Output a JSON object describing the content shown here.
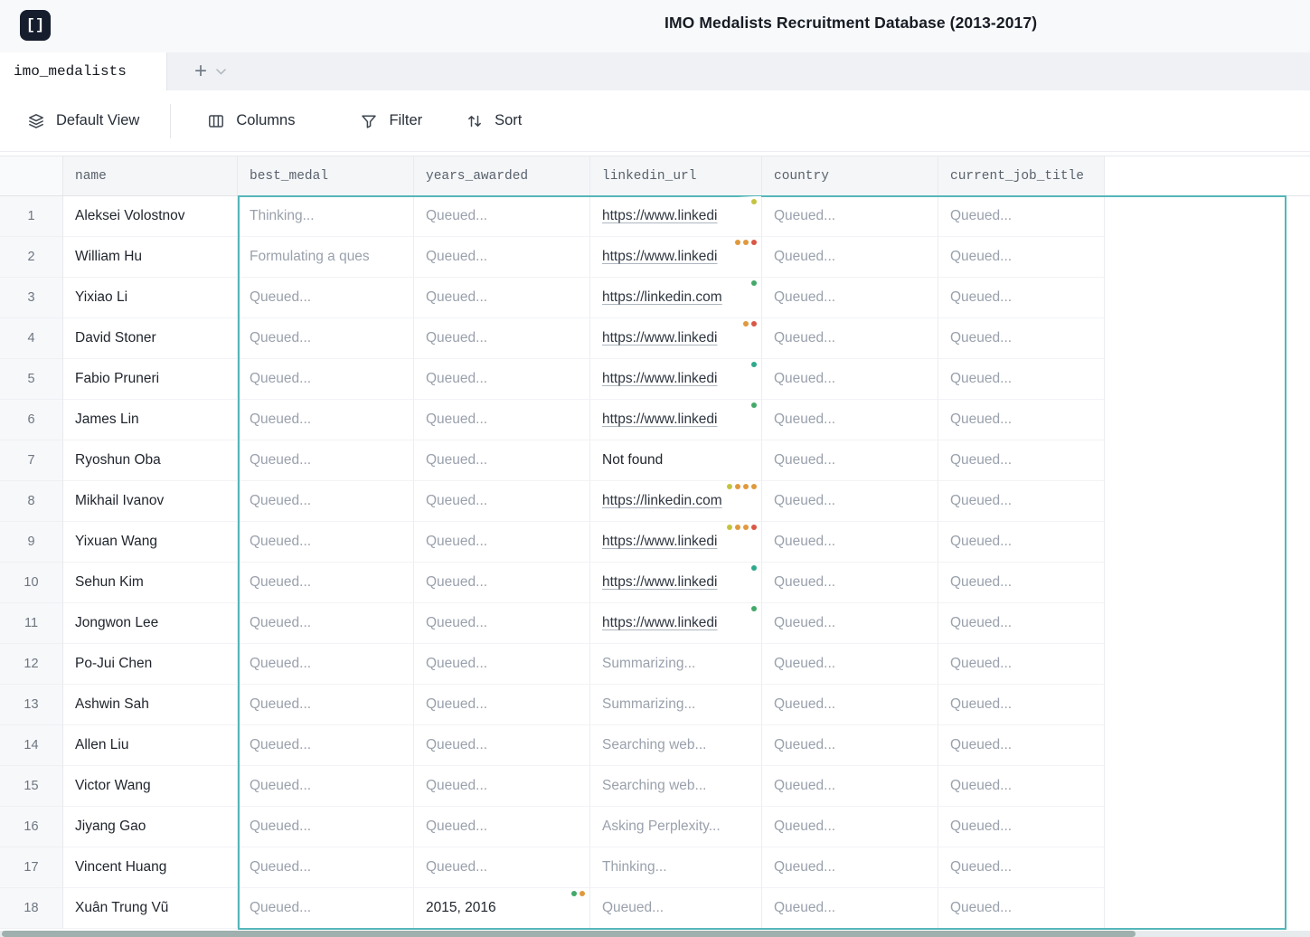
{
  "app": {
    "logo_glyph": "[]",
    "title": "IMO Medalists Recruitment Database (2013-2017)"
  },
  "tab_bar": {
    "active_tab": "imo_medalists",
    "add_tab_label": "+"
  },
  "toolbar": {
    "default_view": "Default View",
    "columns": "Columns",
    "filter": "Filter",
    "sort": "Sort"
  },
  "colors": {
    "selection": "#55b6b9",
    "dot_yellow": "#c5c33e",
    "dot_orange": "#e0993d",
    "dot_red": "#d95745",
    "dot_green": "#43a969",
    "dot_teal": "#2fa98b"
  },
  "table": {
    "columns": [
      "name",
      "best_medal",
      "years_awarded",
      "linkedin_url",
      "country",
      "current_job_title"
    ],
    "rows": [
      {
        "num": "1",
        "cells": [
          {
            "t": "Aleksei Volostnov",
            "k": "name"
          },
          {
            "t": "Thinking...",
            "k": "status"
          },
          {
            "t": "Queued...",
            "k": "status"
          },
          {
            "t": "https://www.linkedi",
            "k": "link",
            "dots": [
              "yellow"
            ]
          },
          {
            "t": "Queued...",
            "k": "status"
          },
          {
            "t": "Queued...",
            "k": "status"
          }
        ]
      },
      {
        "num": "2",
        "cells": [
          {
            "t": "William Hu",
            "k": "name"
          },
          {
            "t": "Formulating a ques",
            "k": "status",
            "fade": true
          },
          {
            "t": "Queued...",
            "k": "status"
          },
          {
            "t": "https://www.linkedi",
            "k": "link",
            "dots": [
              "orange",
              "orange",
              "red"
            ]
          },
          {
            "t": "Queued...",
            "k": "status"
          },
          {
            "t": "Queued...",
            "k": "status"
          }
        ]
      },
      {
        "num": "3",
        "cells": [
          {
            "t": "Yixiao Li",
            "k": "name"
          },
          {
            "t": "Queued...",
            "k": "status"
          },
          {
            "t": "Queued...",
            "k": "status"
          },
          {
            "t": "https://linkedin.com",
            "k": "link",
            "dots": [
              "green"
            ]
          },
          {
            "t": "Queued...",
            "k": "status"
          },
          {
            "t": "Queued...",
            "k": "status"
          }
        ]
      },
      {
        "num": "4",
        "cells": [
          {
            "t": "David Stoner",
            "k": "name"
          },
          {
            "t": "Queued...",
            "k": "status"
          },
          {
            "t": "Queued...",
            "k": "status"
          },
          {
            "t": "https://www.linkedi",
            "k": "link",
            "dots": [
              "orange",
              "red"
            ]
          },
          {
            "t": "Queued...",
            "k": "status"
          },
          {
            "t": "Queued...",
            "k": "status"
          }
        ]
      },
      {
        "num": "5",
        "cells": [
          {
            "t": "Fabio Pruneri",
            "k": "name"
          },
          {
            "t": "Queued...",
            "k": "status"
          },
          {
            "t": "Queued...",
            "k": "status"
          },
          {
            "t": "https://www.linkedi",
            "k": "link",
            "dots": [
              "teal"
            ]
          },
          {
            "t": "Queued...",
            "k": "status"
          },
          {
            "t": "Queued...",
            "k": "status"
          }
        ]
      },
      {
        "num": "6",
        "cells": [
          {
            "t": "James Lin",
            "k": "name"
          },
          {
            "t": "Queued...",
            "k": "status"
          },
          {
            "t": "Queued...",
            "k": "status"
          },
          {
            "t": "https://www.linkedi",
            "k": "link",
            "dots": [
              "green"
            ]
          },
          {
            "t": "Queued...",
            "k": "status"
          },
          {
            "t": "Queued...",
            "k": "status"
          }
        ]
      },
      {
        "num": "7",
        "cells": [
          {
            "t": "Ryoshun Oba",
            "k": "name"
          },
          {
            "t": "Queued...",
            "k": "status"
          },
          {
            "t": "Queued...",
            "k": "status"
          },
          {
            "t": "Not found",
            "k": "text"
          },
          {
            "t": "Queued...",
            "k": "status"
          },
          {
            "t": "Queued...",
            "k": "status"
          }
        ]
      },
      {
        "num": "8",
        "cells": [
          {
            "t": "Mikhail Ivanov",
            "k": "name"
          },
          {
            "t": "Queued...",
            "k": "status"
          },
          {
            "t": "Queued...",
            "k": "status"
          },
          {
            "t": "https://linkedin.com",
            "k": "link",
            "dots": [
              "yellow",
              "orange",
              "orange",
              "orange"
            ]
          },
          {
            "t": "Queued...",
            "k": "status"
          },
          {
            "t": "Queued...",
            "k": "status"
          }
        ]
      },
      {
        "num": "9",
        "cells": [
          {
            "t": "Yixuan Wang",
            "k": "name"
          },
          {
            "t": "Queued...",
            "k": "status"
          },
          {
            "t": "Queued...",
            "k": "status"
          },
          {
            "t": "https://www.linkedi",
            "k": "link",
            "dots": [
              "yellow",
              "orange",
              "orange",
              "red"
            ]
          },
          {
            "t": "Queued...",
            "k": "status"
          },
          {
            "t": "Queued...",
            "k": "status"
          }
        ]
      },
      {
        "num": "10",
        "cells": [
          {
            "t": "Sehun Kim",
            "k": "name"
          },
          {
            "t": "Queued...",
            "k": "status"
          },
          {
            "t": "Queued...",
            "k": "status"
          },
          {
            "t": "https://www.linkedi",
            "k": "link",
            "dots": [
              "teal"
            ]
          },
          {
            "t": "Queued...",
            "k": "status"
          },
          {
            "t": "Queued...",
            "k": "status"
          }
        ]
      },
      {
        "num": "11",
        "cells": [
          {
            "t": "Jongwon Lee",
            "k": "name"
          },
          {
            "t": "Queued...",
            "k": "status"
          },
          {
            "t": "Queued...",
            "k": "status"
          },
          {
            "t": "https://www.linkedi",
            "k": "link",
            "dots": [
              "green"
            ]
          },
          {
            "t": "Queued...",
            "k": "status"
          },
          {
            "t": "Queued...",
            "k": "status"
          }
        ]
      },
      {
        "num": "12",
        "cells": [
          {
            "t": "Po-Jui Chen",
            "k": "name"
          },
          {
            "t": "Queued...",
            "k": "status"
          },
          {
            "t": "Queued...",
            "k": "status"
          },
          {
            "t": "Summarizing...",
            "k": "status"
          },
          {
            "t": "Queued...",
            "k": "status"
          },
          {
            "t": "Queued...",
            "k": "status"
          }
        ]
      },
      {
        "num": "13",
        "cells": [
          {
            "t": "Ashwin Sah",
            "k": "name"
          },
          {
            "t": "Queued...",
            "k": "status"
          },
          {
            "t": "Queued...",
            "k": "status"
          },
          {
            "t": "Summarizing...",
            "k": "status"
          },
          {
            "t": "Queued...",
            "k": "status"
          },
          {
            "t": "Queued...",
            "k": "status"
          }
        ]
      },
      {
        "num": "14",
        "cells": [
          {
            "t": "Allen Liu",
            "k": "name"
          },
          {
            "t": "Queued...",
            "k": "status"
          },
          {
            "t": "Queued...",
            "k": "status"
          },
          {
            "t": "Searching web...",
            "k": "status"
          },
          {
            "t": "Queued...",
            "k": "status"
          },
          {
            "t": "Queued...",
            "k": "status"
          }
        ]
      },
      {
        "num": "15",
        "cells": [
          {
            "t": "Victor Wang",
            "k": "name"
          },
          {
            "t": "Queued...",
            "k": "status"
          },
          {
            "t": "Queued...",
            "k": "status"
          },
          {
            "t": "Searching web...",
            "k": "status"
          },
          {
            "t": "Queued...",
            "k": "status"
          },
          {
            "t": "Queued...",
            "k": "status"
          }
        ]
      },
      {
        "num": "16",
        "cells": [
          {
            "t": "Jiyang Gao",
            "k": "name"
          },
          {
            "t": "Queued...",
            "k": "status"
          },
          {
            "t": "Queued...",
            "k": "status"
          },
          {
            "t": "Asking Perplexity...",
            "k": "status",
            "fade": true
          },
          {
            "t": "Queued...",
            "k": "status"
          },
          {
            "t": "Queued...",
            "k": "status"
          }
        ]
      },
      {
        "num": "17",
        "cells": [
          {
            "t": "Vincent Huang",
            "k": "name"
          },
          {
            "t": "Queued...",
            "k": "status"
          },
          {
            "t": "Queued...",
            "k": "status"
          },
          {
            "t": "Thinking...",
            "k": "status"
          },
          {
            "t": "Queued...",
            "k": "status"
          },
          {
            "t": "Queued...",
            "k": "status"
          }
        ]
      },
      {
        "num": "18",
        "cells": [
          {
            "t": "Xuân Trung Vũ",
            "k": "name"
          },
          {
            "t": "Queued...",
            "k": "status"
          },
          {
            "t": "2015, 2016",
            "k": "text",
            "dots": [
              "green",
              "orange"
            ]
          },
          {
            "t": "Queued...",
            "k": "status"
          },
          {
            "t": "Queued...",
            "k": "status"
          },
          {
            "t": "Queued...",
            "k": "status"
          }
        ]
      }
    ]
  }
}
